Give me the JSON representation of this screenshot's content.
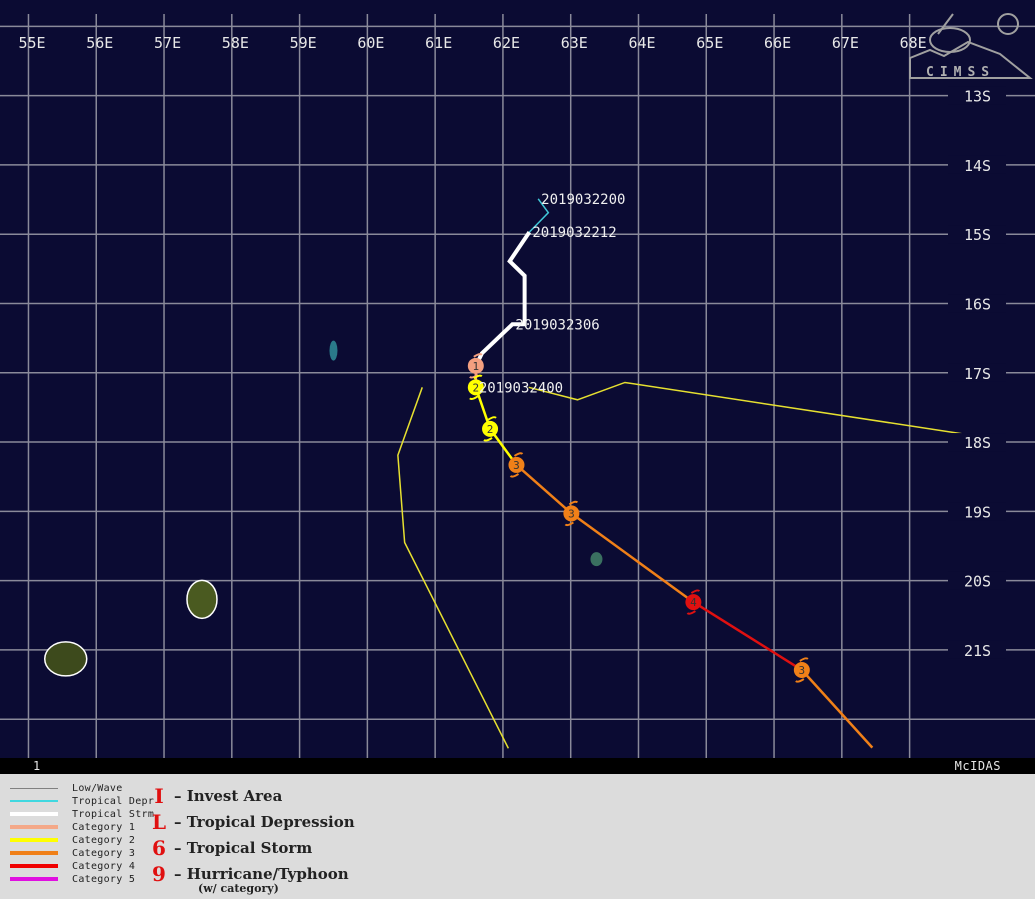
{
  "map": {
    "background_color": "#0b0b33",
    "grid_color": "#8a8a9a",
    "lon_ticks": [
      "55E",
      "56E",
      "57E",
      "58E",
      "59E",
      "60E",
      "61E",
      "62E",
      "63E",
      "64E",
      "65E",
      "66E",
      "67E",
      "68E"
    ],
    "lon_values": [
      55,
      56,
      57,
      58,
      59,
      60,
      61,
      62,
      63,
      64,
      65,
      66,
      67,
      68
    ],
    "lat_ticks": [
      "13S",
      "14S",
      "15S",
      "16S",
      "17S",
      "18S",
      "19S",
      "20S",
      "21S"
    ],
    "lat_values": [
      13,
      14,
      15,
      16,
      17,
      18,
      19,
      20,
      21
    ],
    "lon_range": [
      54.58,
      69.85
    ],
    "lat_range_south": [
      11.62,
      22.56
    ],
    "logo": "CIMSS",
    "track": {
      "segments": [
        {
          "category": "Tropical Depr",
          "color": "#40c8d8",
          "points": [
            [
              62.52,
              14.49
            ],
            [
              62.67,
              14.69
            ],
            [
              62.39,
              14.97
            ]
          ]
        },
        {
          "category": "Tropical Strm",
          "color": "#ffffff",
          "points": [
            [
              62.39,
              14.97
            ],
            [
              62.1,
              15.39
            ],
            [
              62.32,
              15.6
            ],
            [
              62.32,
              16.3
            ],
            [
              62.14,
              16.3
            ],
            [
              61.69,
              16.72
            ],
            [
              61.6,
              16.9
            ]
          ]
        },
        {
          "category": "Category 1",
          "color": "#f4a080",
          "points": [
            [
              61.6,
              16.9
            ],
            [
              61.6,
              17.21
            ]
          ]
        },
        {
          "category": "Category 2",
          "color": "#ffff00",
          "points": [
            [
              61.6,
              17.21
            ],
            [
              61.81,
              17.81
            ],
            [
              62.2,
              18.33
            ]
          ]
        },
        {
          "category": "Category 3",
          "color": "#f08018",
          "points": [
            [
              62.2,
              18.33
            ],
            [
              63.01,
              19.03
            ],
            [
              64.81,
              20.31
            ]
          ]
        },
        {
          "category": "Category 4",
          "color": "#e01010",
          "points": [
            [
              64.81,
              20.31
            ],
            [
              66.41,
              21.29
            ]
          ]
        },
        {
          "category": "Category 3",
          "color": "#f08018",
          "points": [
            [
              66.41,
              21.29
            ],
            [
              67.45,
              22.41
            ]
          ]
        }
      ],
      "markers": [
        {
          "cat": "1",
          "color": "#f4a080",
          "lon": 61.6,
          "lat": 16.9
        },
        {
          "cat": "2",
          "color": "#ffff00",
          "lon": 61.6,
          "lat": 17.21
        },
        {
          "cat": "2",
          "color": "#ffff00",
          "lon": 61.81,
          "lat": 17.81
        },
        {
          "cat": "3",
          "color": "#f08018",
          "lon": 62.2,
          "lat": 18.33
        },
        {
          "cat": "3",
          "color": "#f08018",
          "lon": 63.01,
          "lat": 19.03
        },
        {
          "cat": "4",
          "color": "#e01010",
          "lon": 64.81,
          "lat": 20.31
        },
        {
          "cat": "3",
          "color": "#f08018",
          "lon": 66.41,
          "lat": 21.29
        }
      ],
      "time_labels": [
        {
          "text": "2019032200",
          "lon": 62.52,
          "lat": 14.49
        },
        {
          "text": "2019032212",
          "lon": 62.39,
          "lat": 14.97
        },
        {
          "text": "2019032306",
          "lon": 62.14,
          "lat": 16.3
        },
        {
          "text": "2019032400",
          "lon": 61.6,
          "lat": 17.21
        }
      ]
    },
    "forecast_lines": {
      "color": "#e6e030",
      "lines": [
        [
          [
            60.81,
            17.21
          ],
          [
            60.45,
            18.19
          ],
          [
            60.55,
            19.45
          ],
          [
            62.08,
            22.42
          ]
        ],
        [
          [
            62.38,
            17.21
          ],
          [
            63.1,
            17.39
          ],
          [
            63.8,
            17.14
          ],
          [
            68.77,
            17.88
          ]
        ]
      ]
    },
    "islands": [
      {
        "name": "Reunion",
        "lon": 55.55,
        "lat": 21.13
      },
      {
        "name": "Mauritius",
        "lon": 57.56,
        "lat": 20.27
      },
      {
        "name": "Tromelin",
        "lon": 59.5,
        "lat": 16.68
      },
      {
        "name": "Cargados Carajos",
        "lon": 63.38,
        "lat": 19.69
      }
    ]
  },
  "footer": {
    "frame_number": "1",
    "software": "McIDAS"
  },
  "legend": {
    "lines": [
      {
        "label": "Low/Wave",
        "color": "#808080",
        "thick": 1
      },
      {
        "label": "Tropical Depr",
        "color": "#40d8e0",
        "thick": 2
      },
      {
        "label": "Tropical Strm",
        "color": "#ffffff",
        "thick": 4
      },
      {
        "label": "Category 1",
        "color": "#f4a888",
        "thick": 4
      },
      {
        "label": "Category 2",
        "color": "#ffff00",
        "thick": 4
      },
      {
        "label": "Category 3",
        "color": "#f08018",
        "thick": 4
      },
      {
        "label": "Category 4",
        "color": "#f00000",
        "thick": 4
      },
      {
        "label": "Category 5",
        "color": "#e010e0",
        "thick": 4
      }
    ],
    "symbols": [
      {
        "glyph": "I",
        "label": "– Invest Area"
      },
      {
        "glyph": "L",
        "label": "– Tropical Depression"
      },
      {
        "glyph": "6",
        "label": "– Tropical Storm"
      },
      {
        "glyph": "9",
        "label": "– Hurricane/Typhoon"
      }
    ],
    "note": "(w/ category)"
  }
}
